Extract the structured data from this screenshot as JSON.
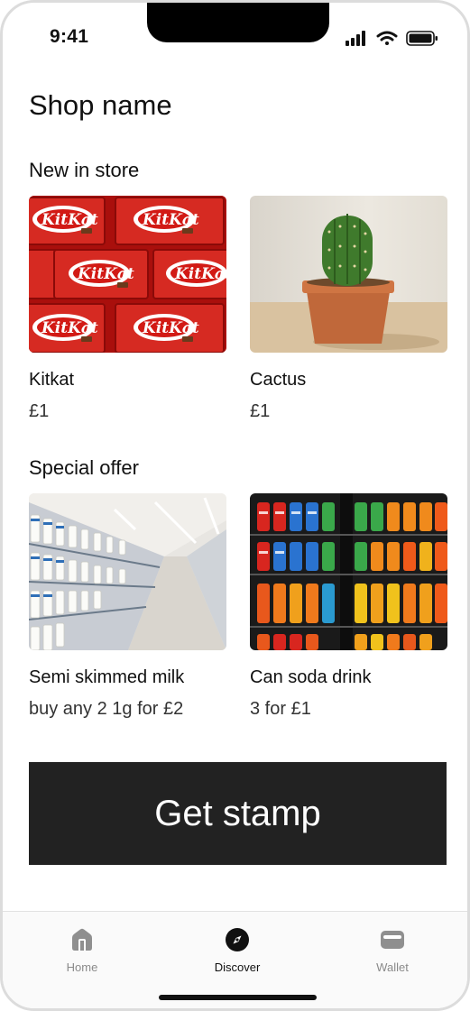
{
  "status": {
    "time": "9:41"
  },
  "shop": {
    "name": "Shop name"
  },
  "sections": {
    "new_in_store": {
      "title": "New in store",
      "items": [
        {
          "name": "Kitkat",
          "price": "£1",
          "image_icon": "kitkat-bars-image"
        },
        {
          "name": "Cactus",
          "price": "£1",
          "image_icon": "potted-cactus-image"
        }
      ]
    },
    "special_offer": {
      "title": "Special offer",
      "items": [
        {
          "name": "Semi skimmed milk",
          "price": "buy any 2 1g for £2",
          "image_icon": "milk-aisle-image"
        },
        {
          "name": "Can soda drink",
          "price": "3 for £1",
          "image_icon": "soda-fridge-image"
        }
      ]
    }
  },
  "actions": {
    "get_stamp": "Get stamp"
  },
  "tabbar": {
    "items": [
      {
        "label": "Home",
        "icon": "home-icon",
        "active": false
      },
      {
        "label": "Discover",
        "icon": "compass-icon",
        "active": true
      },
      {
        "label": "Wallet",
        "icon": "wallet-icon",
        "active": false
      }
    ]
  },
  "colors": {
    "button_bg": "#222222",
    "kitkat_red": "#d51f1b",
    "cactus_green": "#3f7a2c",
    "pot_terracotta": "#c0683a",
    "tab_inactive": "#8a8a8a"
  }
}
